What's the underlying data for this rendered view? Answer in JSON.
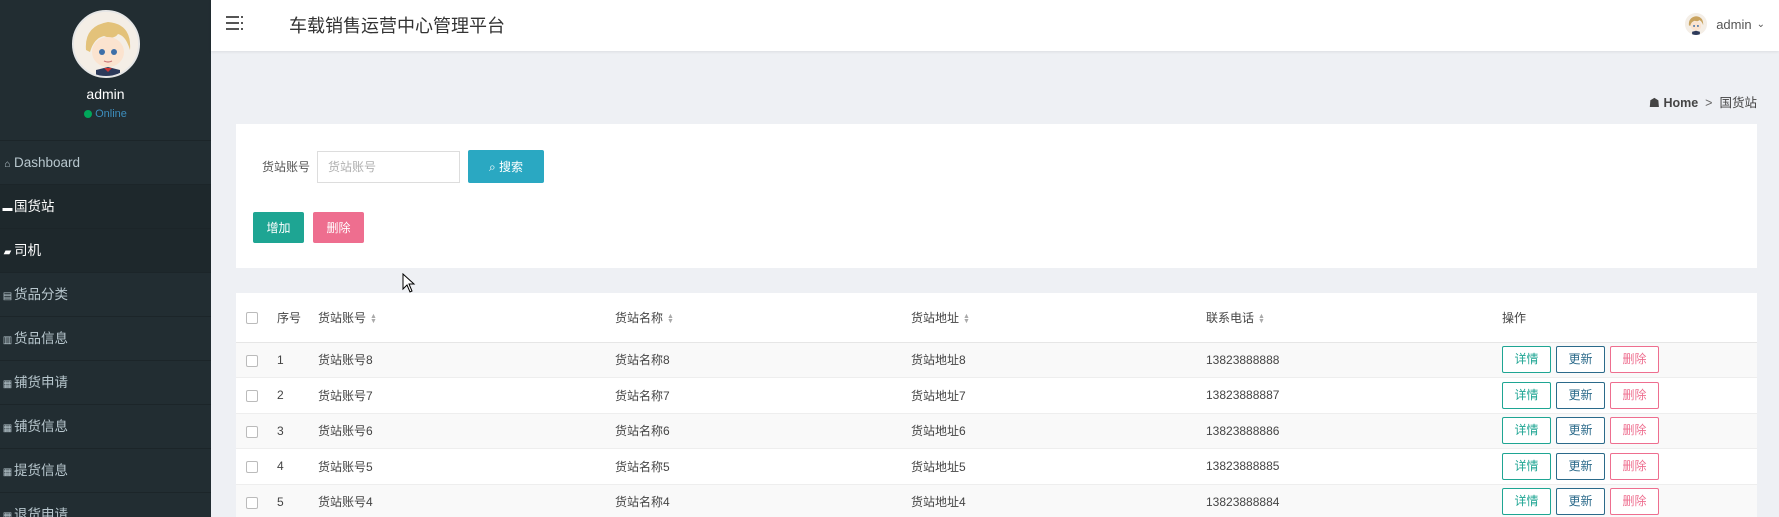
{
  "sidebar": {
    "user_name": "admin",
    "status": "Online",
    "items": [
      {
        "label": "Dashboard",
        "icon": "home-icon"
      },
      {
        "label": "国货站",
        "icon": "square-icon"
      },
      {
        "label": "司机",
        "icon": "comment-icon"
      },
      {
        "label": "货品分类",
        "icon": "list-icon"
      },
      {
        "label": "货品信息",
        "icon": "bar-icon"
      },
      {
        "label": "铺货申请",
        "icon": "grid-icon"
      },
      {
        "label": "铺货信息",
        "icon": "grid-icon"
      },
      {
        "label": "提货信息",
        "icon": "grid-icon"
      },
      {
        "label": "退货申请",
        "icon": "grid-icon"
      }
    ]
  },
  "header": {
    "title": "车载销售运营中心管理平台",
    "user": "admin"
  },
  "breadcrumb": {
    "home": "Home",
    "separator": ">",
    "current": "国货站"
  },
  "search": {
    "label": "货站账号",
    "placeholder": "货站账号",
    "button": "搜索"
  },
  "actions": {
    "add": "增加",
    "delete": "删除"
  },
  "table": {
    "headers": {
      "index": "序号",
      "account": "货站账号",
      "name": "货站名称",
      "address": "货站地址",
      "phone": "联系电话",
      "ops": "操作"
    },
    "op_labels": {
      "detail": "详情",
      "update": "更新",
      "delete": "删除"
    },
    "rows": [
      {
        "index": "1",
        "account": "货站账号8",
        "name": "货站名称8",
        "address": "货站地址8",
        "phone": "13823888888"
      },
      {
        "index": "2",
        "account": "货站账号7",
        "name": "货站名称7",
        "address": "货站地址7",
        "phone": "13823888887"
      },
      {
        "index": "3",
        "account": "货站账号6",
        "name": "货站名称6",
        "address": "货站地址6",
        "phone": "13823888886"
      },
      {
        "index": "4",
        "account": "货站账号5",
        "name": "货站名称5",
        "address": "货站地址5",
        "phone": "13823888885"
      },
      {
        "index": "5",
        "account": "货站账号4",
        "name": "货站名称4",
        "address": "货站地址4",
        "phone": "13823888884"
      }
    ]
  },
  "colors": {
    "sidebar_bg": "#222d32",
    "search_btn": "#2aa8c2",
    "add_btn": "#1ea593",
    "delete_btn": "#ee6e8f",
    "status_dot": "#00a65a"
  }
}
